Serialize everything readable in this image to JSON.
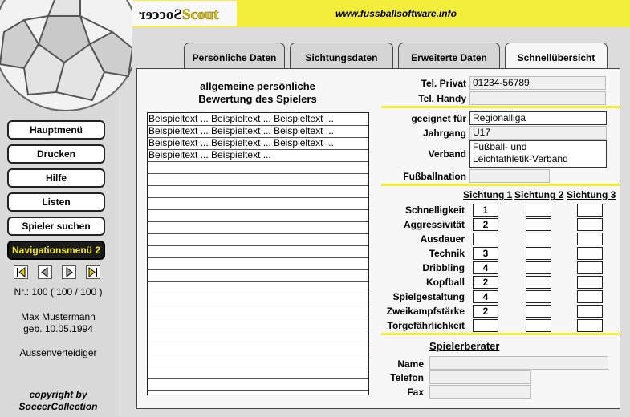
{
  "header": {
    "logo_text": "SoccerScout",
    "website": "www.fussballsoftware.info"
  },
  "sidebar": {
    "buttons": [
      "Hauptmenü",
      "Drucken",
      "Hilfe",
      "Listen",
      "Spieler suchen",
      "Navigationsmenü 2"
    ],
    "record": "Nr.: 100 ( 100 / 100 )",
    "player_name": "Max Mustermann",
    "birth": "geb. 10.05.1994",
    "position": "Aussenverteidiger",
    "copyright_line1": "copyright by",
    "copyright_line2": "SoccerCollection"
  },
  "tabs": [
    "Persönliche Daten",
    "Sichtungsdaten",
    "Erweiterte Daten",
    "Schnellübersicht"
  ],
  "evaluation": {
    "title_line1": "allgemeine persönliche",
    "title_line2": "Bewertung des Spielers",
    "lines": [
      "Beispieltext ... Beispieltext ... Beispieltext ...",
      "Beispieltext ... Beispieltext ... Beispieltext ...",
      "Beispieltext ... Beispieltext ... Beispieltext ...",
      "Beispieltext ... Beispieltext ..."
    ]
  },
  "contact": {
    "tel_privat_label": "Tel. Privat",
    "tel_privat": "01234-56789",
    "tel_handy_label": "Tel. Handy",
    "tel_handy": ""
  },
  "suitability": {
    "geeignet_label": "geeignet für",
    "geeignet": "Regionalliga",
    "jahrgang_label": "Jahrgang",
    "jahrgang": "U17",
    "verband_label": "Verband",
    "verband_line1": "Fußball- und",
    "verband_line2": "Leichtathletik-Verband",
    "nation_label": "Fußballnation",
    "nation": ""
  },
  "ratings": {
    "headers": [
      "Sichtung 1",
      "Sichtung 2",
      "Sichtung 3"
    ],
    "rows": [
      {
        "label": "Schnelligkeit",
        "values": [
          "1",
          "",
          ""
        ]
      },
      {
        "label": "Aggressivität",
        "values": [
          "2",
          "",
          ""
        ]
      },
      {
        "label": "Ausdauer",
        "values": [
          "",
          "",
          ""
        ]
      },
      {
        "label": "Technik",
        "values": [
          "3",
          "",
          ""
        ]
      },
      {
        "label": "Dribbling",
        "values": [
          "4",
          "",
          ""
        ]
      },
      {
        "label": "Kopfball",
        "values": [
          "2",
          "",
          ""
        ]
      },
      {
        "label": "Spielgestaltung",
        "values": [
          "4",
          "",
          ""
        ]
      },
      {
        "label": "Zweikampfstärke",
        "values": [
          "2",
          "",
          ""
        ]
      },
      {
        "label": "Torgefährlichkeit",
        "values": [
          "",
          "",
          ""
        ]
      }
    ]
  },
  "berater": {
    "title": "Spielerberater",
    "name_label": "Name",
    "name": "",
    "telefon_label": "Telefon",
    "telefon": "",
    "fax_label": "Fax",
    "fax": ""
  },
  "colors": {
    "accent_yellow": "#f3ee3c",
    "dark": "#1a1a1a"
  }
}
